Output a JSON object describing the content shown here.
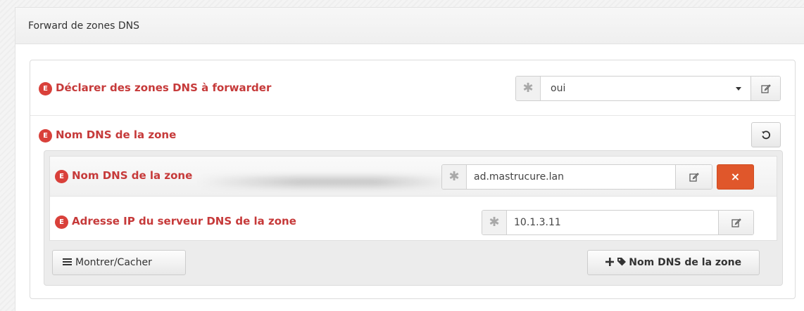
{
  "panel": {
    "title": "Forward de zones DNS"
  },
  "fields": {
    "declare_zones": {
      "badge": "E",
      "label": "Déclarer des zones DNS à forwarder",
      "required_marker": "✱",
      "value": "oui",
      "mandatory_icon": "asterisk-icon",
      "edit_icon": "edit-icon",
      "dropdown_icon": "chevron-down-icon"
    },
    "zone_name_group": {
      "badge": "E",
      "label": "Nom DNS de la zone",
      "reset_icon": "undo-icon"
    },
    "zone_name": {
      "badge": "E",
      "label": "Nom DNS de la zone",
      "required_marker": "✱",
      "value": "ad.mastrucure.lan",
      "edit_icon": "edit-icon",
      "remove_label": "×"
    },
    "zone_ip": {
      "badge": "E",
      "label": "Adresse IP du serveur DNS de la zone",
      "required_marker": "✱",
      "value": "10.1.3.11",
      "edit_icon": "edit-icon"
    }
  },
  "actions": {
    "toggle_label": "Montrer/Cacher",
    "toggle_icon": "menu-icon",
    "add_label": "Nom DNS de la zone",
    "add_icon": "plus-icon",
    "tag_icon": "tag-icon"
  },
  "colors": {
    "label_red": "#c63a3a",
    "badge_red": "#d9403a",
    "danger_orange": "#e0572b"
  }
}
